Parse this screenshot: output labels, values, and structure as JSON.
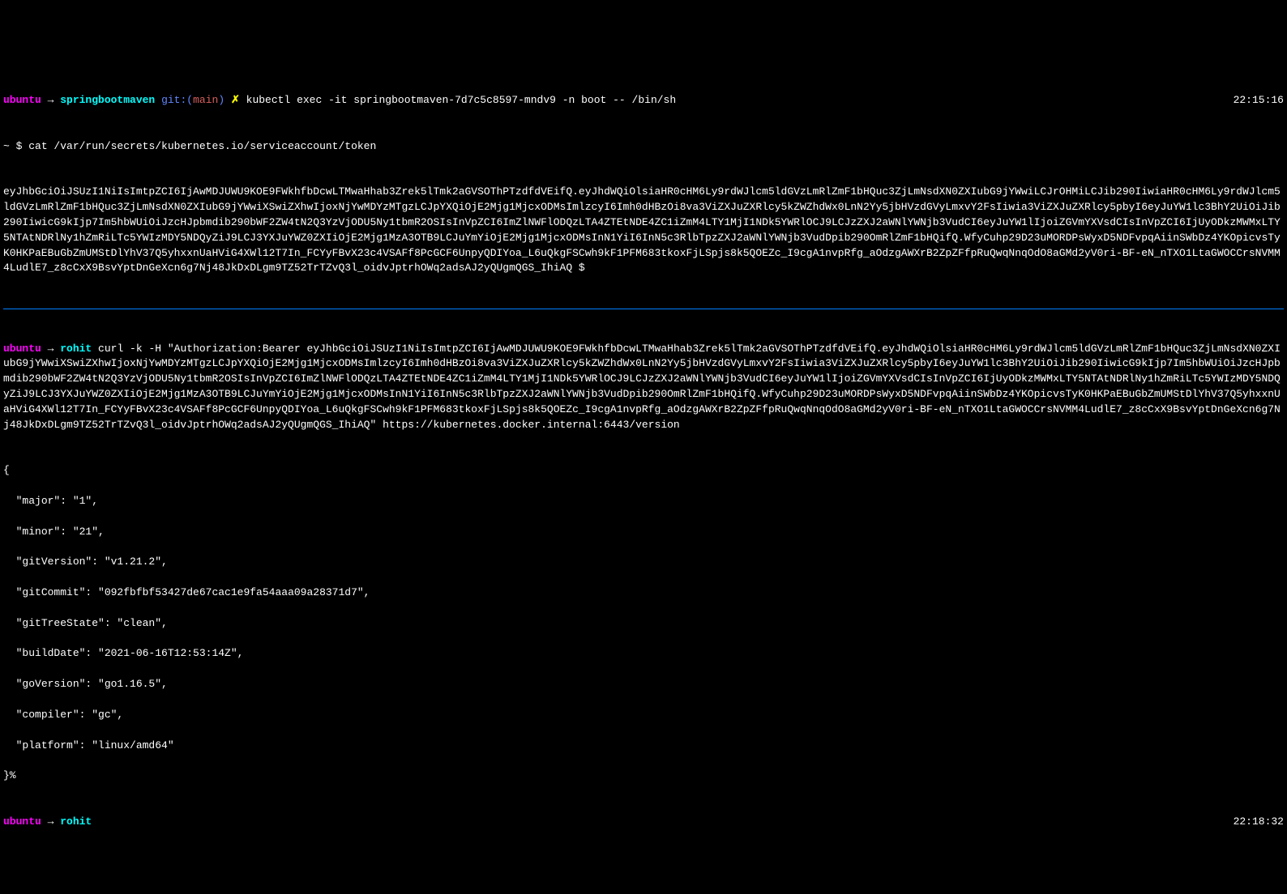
{
  "line1": {
    "user": "ubuntu",
    "dir": "springbootmaven",
    "git_label": "git:",
    "branch": "main",
    "x": "✗",
    "command": "kubectl exec -it springbootmaven-7d7c5c8597-mndv9 -n boot -- /bin/sh",
    "time": "22:15:16"
  },
  "line2": {
    "prompt": "~ $ ",
    "command": "cat /var/run/secrets/kubernetes.io/serviceaccount/token"
  },
  "token_output": "eyJhbGciOiJSUzI1NiIsImtpZCI6IjAwMDJUWU9KOE9FWkhfbDcwLTMwaHhab3Zrek5lTmk2aGVSOThPTzdfdVEifQ.eyJhdWQiOlsiaHR0cHM6Ly9rdWJlcm5ldGVzLmRlZmF1bHQuc3ZjLmNsdXN0ZXIubG9jYWwiLCJrOHMiLCJib290IiwiaHR0cHM6Ly9rdWJlcm5ldGVzLmRlZmF1bHQuc3ZjLmNsdXN0ZXIubG9jYWwiXSwiZXhwIjoxNjYwMDYzMTgzLCJpYXQiOjE2Mjg1MjcxODMsImlzcyI6Imh0dHBzOi8va3ViZXJuZXRlcy5kZWZhdWx0LnN2Yy5jbHVzdGVyLmxvY2FsIiwia3ViZXJuZXRlcy5pbyI6eyJuYW1lc3BhY2UiOiJib290IiwicG9kIjp7Im5hbWUiOiJzcHJpbmdib290bWF2ZW4tN2Q3YzVjODU5Ny1tbmR2OSIsInVpZCI6ImZlNWFlODQzLTA4ZTEtNDE4ZC1iZmM4LTY1MjI1NDk5YWRlOCJ9LCJzZXJ2aWNlYWNjb3VudCI6eyJuYW1lIjoiZGVmYXVsdCIsInVpZCI6IjUyODkzMWMxLTY5NTAtNDRlNy1hZmRiLTc5YWIzMDY5NDQyZiJ9LCJ3YXJuYWZ0ZXIiOjE2Mjg1MzA3OTB9LCJuYmYiOjE2Mjg1MjcxODMsInN1YiI6InN5c3RlbTpzZXJ2aWNlYWNjb3VudDpib290OmRlZmF1bHQifQ.WfyCuhp29D23uMORDPsWyxD5NDFvpqAiinSWbDz4YKOpicvsTyK0HKPaEBuGbZmUMStDlYhV37Q5yhxxnUaHViG4XWl12T7In_FCYyFBvX23c4VSAFf8PcGCF6UnpyQDIYoa_L6uQkgFSCwh9kF1PFM683tkoxFjLSpjs8k5QOEZc_I9cgA1nvpRfg_aOdzgAWXrB2ZpZFfpRuQwqNnqOdO8aGMd2yV0ri-BF-eN_nTXO1LtaGWOCCrsNVMM4LudlE7_z8cCxX9BsvYptDnGeXcn6g7Nj48JkDxDLgm9TZ52TrTZvQ3l_oidvJptrhOWq2adsAJ2yQUgmQGS_IhiAQ",
  "inner_prompt_end": " $ ",
  "line3": {
    "user": "ubuntu",
    "dir": "rohit",
    "command": "curl -k -H \"Authorization:Bearer eyJhbGciOiJSUzI1NiIsImtpZCI6IjAwMDJUWU9KOE9FWkhfbDcwLTMwaHhab3Zrek5lTmk2aGVSOThPTzdfdVEifQ.eyJhdWQiOlsiaHR0cHM6Ly9rdWJlcm5ldGVzLmRlZmF1bHQuc3ZjLmNsdXN0ZXIubG9jYWwiXSwiZXhwIjoxNjYwMDYzMTgzLCJpYXQiOjE2Mjg1MjcxODMsImlzcyI6Imh0dHBzOi8va3ViZXJuZXRlcy5kZWZhdWx0LnN2Yy5jbHVzdGVyLmxvY2FsIiwia3ViZXJuZXRlcy5pbyI6eyJuYW1lc3BhY2UiOiJib290IiwicG9kIjp7Im5hbWUiOiJzcHJpbmdib290bWF2ZW4tN2Q3YzVjODU5Ny1tbmR2OSIsInVpZCI6ImZlNWFlODQzLTA4ZTEtNDE4ZC1iZmM4LTY1MjI1NDk5YWRlOCJ9LCJzZXJ2aWNlYWNjb3VudCI6eyJuYW1lIjoiZGVmYXVsdCIsInVpZCI6IjUyODkzMWMxLTY5NTAtNDRlNy1hZmRiLTc5YWIzMDY5NDQyZiJ9LCJ3YXJuYWZ0ZXIiOjE2Mjg1MzA3OTB9LCJuYmYiOjE2Mjg1MjcxODMsInN1YiI6InN5c3RlbTpzZXJ2aWNlYWNjb3VudDpib290OmRlZmF1bHQifQ.WfyCuhp29D23uMORDPsWyxD5NDFvpqAiinSWbDz4YKOpicvsTyK0HKPaEBuGbZmUMStDlYhV37Q5yhxxnUaHViG4XWl12T7In_FCYyFBvX23c4VSAFf8PcGCF6UnpyQDIYoa_L6uQkgFSCwh9kF1PFM683tkoxFjLSpjs8k5QOEZc_I9cgA1nvpRfg_aOdzgAWXrB2ZpZFfpRuQwqNnqOdO8aGMd2yV0ri-BF-eN_nTXO1LtaGWOCCrsNVMM4LudlE7_z8cCxX9BsvYptDnGeXcn6g7Nj48JkDxDLgm9TZ52TrTZvQ3l_oidvJptrhOWq2adsAJ2yQUgmQGS_IhiAQ\" https://kubernetes.docker.internal:6443/version"
  },
  "json_response": {
    "open": "{",
    "rows": [
      "  \"major\": \"1\",",
      "  \"minor\": \"21\",",
      "  \"gitVersion\": \"v1.21.2\",",
      "  \"gitCommit\": \"092fbfbf53427de67cac1e9fa54aaa09a28371d7\",",
      "  \"gitTreeState\": \"clean\",",
      "  \"buildDate\": \"2021-06-16T12:53:14Z\",",
      "  \"goVersion\": \"go1.16.5\",",
      "  \"compiler\": \"gc\",",
      "  \"platform\": \"linux/amd64\""
    ],
    "close": "}%"
  },
  "line4": {
    "user": "ubuntu",
    "dir": "rohit",
    "time": "22:18:32"
  }
}
